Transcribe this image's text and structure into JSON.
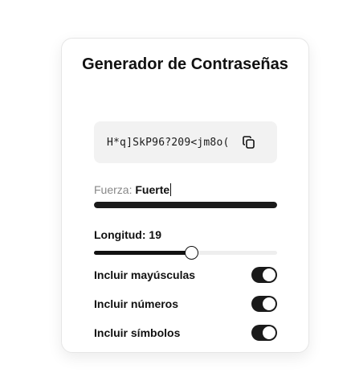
{
  "title": "Generador de Contraseñas",
  "password": {
    "value": "H*q]SkP96?209<jm8o(",
    "copy_icon": "copy-icon"
  },
  "strength": {
    "label": "Fuerza:",
    "value": "Fuerte",
    "level": 1.0
  },
  "length": {
    "label": "Longitud: 19",
    "value": 19,
    "slider_fraction": 0.53
  },
  "options": [
    {
      "label": "Incluir mayúsculas",
      "enabled": true
    },
    {
      "label": "Incluir números",
      "enabled": true
    },
    {
      "label": "Incluir símbolos",
      "enabled": true
    }
  ],
  "colors": {
    "accent": "#1a1a1a",
    "muted_label": "#888888",
    "password_bg": "#f2f2f2"
  }
}
